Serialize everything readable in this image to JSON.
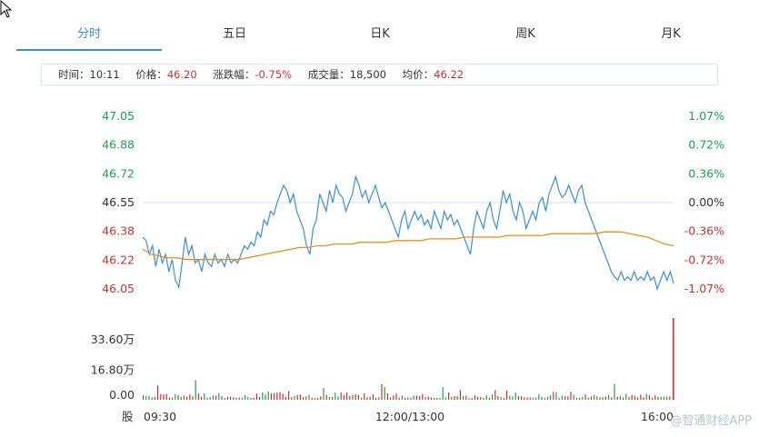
{
  "tabs": [
    {
      "label": "分时",
      "active": true
    },
    {
      "label": "五日",
      "active": false
    },
    {
      "label": "日K",
      "active": false
    },
    {
      "label": "周K",
      "active": false
    },
    {
      "label": "月K",
      "active": false
    }
  ],
  "info": {
    "time_label": "时间：",
    "time": "10:11",
    "price_label": "价格：",
    "price": "46.20",
    "change_label": "涨跌幅：",
    "change": "-0.75%",
    "volume_label": "成交量：",
    "volume": "18,500",
    "avg_label": "均价：",
    "avg": "46.22"
  },
  "watermark": "@智通财经APP",
  "colors": {
    "up": "#1aa34a",
    "down": "#d0302a",
    "price_line": "#3a8fd9",
    "avg_line": "#e8901a",
    "tab_active": "#3a8fd9"
  },
  "chart_data": {
    "type": "line",
    "prev_close": 46.55,
    "price_ticks_left": [
      "47.05",
      "46.88",
      "46.72",
      "46.55",
      "46.38",
      "46.22",
      "46.05"
    ],
    "pct_ticks_right": [
      "1.07%",
      "0.72%",
      "0.36%",
      "0.00%",
      "-0.36%",
      "-0.72%",
      "-1.07%"
    ],
    "x_ticks": [
      "09:30",
      "12:00/13:00",
      "16:00"
    ],
    "ylim": [
      46.05,
      47.05
    ],
    "series": [
      {
        "values": [
          46.35,
          46.33,
          46.25,
          46.3,
          46.18,
          46.28,
          46.2,
          46.25,
          46.15,
          46.22,
          46.1,
          46.06,
          46.2,
          46.35,
          46.25,
          46.3,
          46.2,
          46.22,
          46.15,
          46.25,
          46.2,
          46.18,
          46.25,
          46.2,
          46.22,
          46.18,
          46.25,
          46.2,
          46.22,
          46.2,
          46.25,
          46.3,
          46.28,
          46.32,
          46.3,
          46.38,
          46.35,
          46.45,
          46.42,
          46.5,
          46.48,
          46.55,
          46.6,
          46.65,
          46.62,
          46.55,
          46.6,
          46.5,
          46.45,
          46.4,
          46.3,
          46.25,
          46.4,
          46.45,
          46.6,
          46.55,
          46.5,
          46.62,
          46.55,
          46.65,
          46.6,
          46.58,
          46.5,
          46.55,
          46.6,
          46.7,
          46.65,
          46.58,
          46.62,
          46.55,
          46.6,
          46.65,
          46.58,
          46.52,
          46.55,
          46.5,
          46.45,
          46.4,
          46.35,
          46.45,
          46.5,
          46.4,
          46.45,
          46.5,
          46.45,
          46.48,
          46.42,
          46.45,
          46.4,
          46.5,
          46.45,
          46.4,
          46.5,
          46.45,
          46.48,
          46.42,
          46.45,
          46.4,
          46.35,
          46.3,
          46.25,
          46.4,
          46.5,
          46.45,
          46.4,
          46.5,
          46.55,
          46.45,
          46.4,
          46.5,
          46.62,
          46.55,
          46.6,
          46.5,
          46.45,
          46.55,
          46.5,
          46.4,
          46.45,
          46.5,
          46.45,
          46.55,
          46.58,
          46.5,
          46.6,
          46.65,
          46.7,
          46.62,
          46.58,
          46.6,
          46.65,
          46.6,
          46.55,
          46.62,
          46.65,
          46.55,
          46.5,
          46.45,
          46.4,
          46.35,
          46.3,
          46.25,
          46.2,
          46.15,
          46.12,
          46.1,
          46.15,
          46.1,
          46.12,
          46.1,
          46.15,
          46.1,
          46.12,
          46.1,
          46.15,
          46.1,
          46.12,
          46.05,
          46.1,
          46.15,
          46.1,
          46.15,
          46.08
        ]
      },
      {
        "values": [
          46.28,
          46.25,
          46.24,
          46.23,
          46.23,
          46.22,
          46.22,
          46.22,
          46.22,
          46.22,
          46.22,
          46.22,
          46.23,
          46.24,
          46.25,
          46.26,
          46.27,
          46.28,
          46.29,
          46.29,
          46.3,
          46.3,
          46.31,
          46.31,
          46.31,
          46.32,
          46.32,
          46.32,
          46.32,
          46.33,
          46.33,
          46.33,
          46.33,
          46.34,
          46.34,
          46.34,
          46.34,
          46.35,
          46.35,
          46.35,
          46.35,
          46.35,
          46.36,
          46.36,
          46.36,
          46.36,
          46.36,
          46.37,
          46.37,
          46.37,
          46.37,
          46.37,
          46.37,
          46.38,
          46.38,
          46.38,
          46.37,
          46.36,
          46.35,
          46.33,
          46.31,
          46.3
        ]
      }
    ],
    "volume_ticks": [
      "33.60万",
      "16.80万",
      "0.00"
    ],
    "volume_unit": "股",
    "volume_max": 33.6
  }
}
